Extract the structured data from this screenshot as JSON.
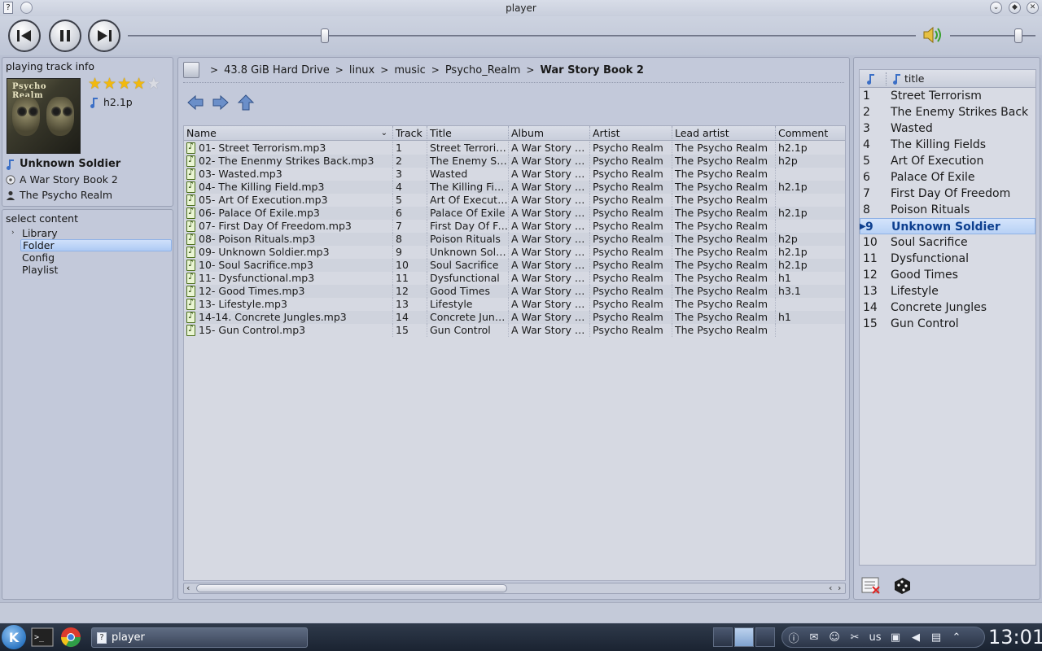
{
  "window": {
    "title": "player"
  },
  "info": {
    "panel_title": "playing track info",
    "art_text": "Psycho Realm",
    "rating": 4,
    "comment": "h2.1p",
    "track": "Unknown Soldier",
    "album": "A War Story Book 2",
    "artist": "The Psycho Realm"
  },
  "content": {
    "panel_title": "select content",
    "items": [
      {
        "label": "Library",
        "expandable": true
      },
      {
        "label": "Folder",
        "selected": true
      },
      {
        "label": "Config"
      },
      {
        "label": "Playlist"
      }
    ]
  },
  "breadcrumb": {
    "parts": [
      "43.8 GiB Hard Drive",
      "linux",
      "music",
      "Psycho_Realm",
      "War Story Book 2"
    ]
  },
  "table": {
    "columns": [
      "Name",
      "Track",
      "Title",
      "Album",
      "Artist",
      "Lead artist",
      "Comment"
    ],
    "rows": [
      [
        "01- Street Terrorism.mp3",
        "1",
        "Street Terrorism",
        "A War Story Book 2",
        "Psycho Realm",
        "The Psycho Realm",
        "h2.1p"
      ],
      [
        "02- The Enenmy Strikes Back.mp3",
        "2",
        "The Enemy Strikes Back",
        "A War Story Book 2",
        "Psycho Realm",
        "The Psycho Realm",
        "h2p"
      ],
      [
        "03- Wasted.mp3",
        "3",
        "Wasted",
        "A War Story Book 2",
        "Psycho Realm",
        "The Psycho Realm",
        ""
      ],
      [
        "04- The Killing Field.mp3",
        "4",
        "The Killing Fields",
        "A War Story Book 2",
        "Psycho Realm",
        "The Psycho Realm",
        "h2.1p"
      ],
      [
        "05- Art Of Execution.mp3",
        "5",
        "Art Of Execution",
        "A War Story Book 2",
        "Psycho Realm",
        "The Psycho Realm",
        ""
      ],
      [
        "06- Palace Of Exile.mp3",
        "6",
        "Palace Of Exile",
        "A War Story Book 2",
        "Psycho Realm",
        "The Psycho Realm",
        "h2.1p"
      ],
      [
        "07- First Day Of Freedom.mp3",
        "7",
        "First Day Of Freedom",
        "A War Story Book 2",
        "Psycho Realm",
        "The Psycho Realm",
        ""
      ],
      [
        "08- Poison Rituals.mp3",
        "8",
        "Poison Rituals",
        "A War Story Book 2",
        "Psycho Realm",
        "The Psycho Realm",
        "h2p"
      ],
      [
        "09- Unknown Soldier.mp3",
        "9",
        "Unknown Soldier",
        "A War Story Book 2",
        "Psycho Realm",
        "The Psycho Realm",
        "h2.1p"
      ],
      [
        "10- Soul Sacrifice.mp3",
        "10",
        "Soul Sacrifice",
        "A War Story Book 2",
        "Psycho Realm",
        "The Psycho Realm",
        "h2.1p"
      ],
      [
        "11-  Dysfunctional.mp3",
        "11",
        "Dysfunctional",
        "A War Story Book 2",
        "Psycho Realm",
        "The Psycho Realm",
        "h1"
      ],
      [
        "12- Good Times.mp3",
        "12",
        "Good Times",
        "A War Story Book 2",
        "Psycho Realm",
        "The Psycho Realm",
        "h3.1"
      ],
      [
        "13- Lifestyle.mp3",
        "13",
        "Lifestyle",
        "A War Story Book 2",
        "Psycho Realm",
        "The Psycho Realm",
        ""
      ],
      [
        "14-14. Concrete Jungles.mp3",
        "14",
        "Concrete Jungles",
        "A War Story Book 2",
        "Psycho Realm",
        "The Psycho Realm",
        "h1"
      ],
      [
        "15- Gun Control.mp3",
        "15",
        "Gun Control",
        "A War Story Book 2",
        "Psycho Realm",
        "The Psycho Realm",
        ""
      ]
    ]
  },
  "playlist": {
    "column_title": "title",
    "current_index": 8,
    "items": [
      {
        "num": "1",
        "title": "Street Terrorism"
      },
      {
        "num": "2",
        "title": "The Enemy Strikes Back"
      },
      {
        "num": "3",
        "title": "Wasted"
      },
      {
        "num": "4",
        "title": "The Killing Fields"
      },
      {
        "num": "5",
        "title": "Art Of Execution"
      },
      {
        "num": "6",
        "title": "Palace Of Exile"
      },
      {
        "num": "7",
        "title": "First Day Of Freedom"
      },
      {
        "num": "8",
        "title": "Poison Rituals"
      },
      {
        "num": "9",
        "title": "Unknown Soldier"
      },
      {
        "num": "10",
        "title": "Soul Sacrifice"
      },
      {
        "num": "11",
        "title": "Dysfunctional"
      },
      {
        "num": "12",
        "title": "Good Times"
      },
      {
        "num": "13",
        "title": "Lifestyle"
      },
      {
        "num": "14",
        "title": "Concrete Jungles"
      },
      {
        "num": "15",
        "title": "Gun Control"
      }
    ]
  },
  "controls": {
    "seek_fraction": 0.25,
    "volume_fraction": 0.8,
    "icons": [
      "previous-icon",
      "pause-icon",
      "next-icon",
      "volume-icon"
    ]
  },
  "taskbar": {
    "task_label": "player",
    "tray_keyboard": "us",
    "clock": "13:01"
  },
  "colors": {
    "accent": "#2f78c4",
    "selection": "#aecaf4",
    "star": "#f2b90d"
  }
}
